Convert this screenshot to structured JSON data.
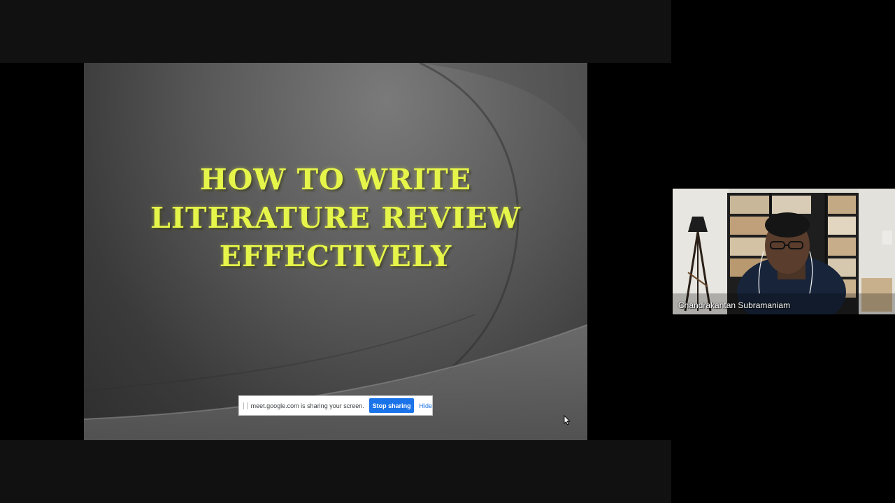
{
  "presentation": {
    "title_lines": [
      "HOW TO WRITE",
      "LITERATURE REVIEW",
      "EFFECTIVELY"
    ],
    "title_color": "#e6f54a"
  },
  "share_bar": {
    "message": "meet.google.com is sharing your screen.",
    "stop_label": "Stop sharing",
    "hide_label": "Hide",
    "accent": "#1a73e8"
  },
  "participant": {
    "name": "Chandrakantan Subramaniam"
  },
  "icons": {
    "cursor": "mouse-pointer-icon",
    "drag": "drag-handle-icon"
  }
}
